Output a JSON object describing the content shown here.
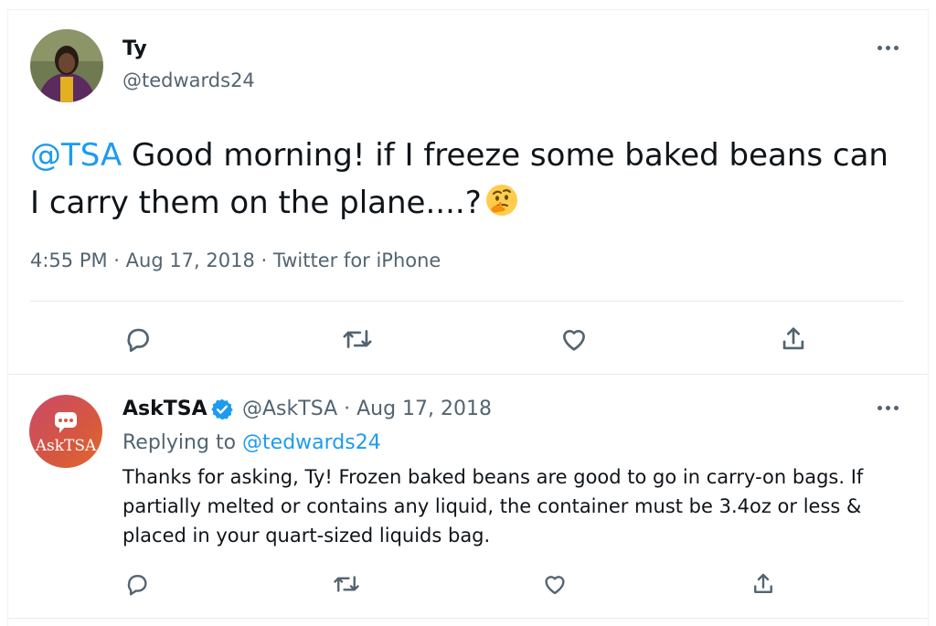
{
  "main_tweet": {
    "name": "Ty",
    "handle": "@tedwards24",
    "mention": "@TSA",
    "text": " Good morning!  if I freeze some baked beans can I carry them on the plane....?",
    "emoji_icon": "thinking-face",
    "timestamp": "4:55 PM · Aug 17, 2018 · Twitter for iPhone"
  },
  "reply_tweet": {
    "name": "AskTSA",
    "verified": true,
    "handle_date": "@AskTSA · Aug 17, 2018",
    "replying_prefix": "Replying to ",
    "replying_to": "@tedwards24",
    "avatar_text": "AskTSA",
    "text": "Thanks for asking, Ty! Frozen baked beans are good to go in carry-on bags. If partially melted or contains any liquid, the container must be 3.4oz or less & placed in your quart-sized liquids bag."
  },
  "actions": [
    "reply-icon",
    "retweet-icon",
    "like-icon",
    "share-icon"
  ],
  "colors": {
    "accent": "#1d9bf0",
    "muted": "#536471",
    "text": "#0f1419",
    "tsa_gradient_start": "#c94a6a",
    "tsa_gradient_end": "#e06a2f"
  }
}
